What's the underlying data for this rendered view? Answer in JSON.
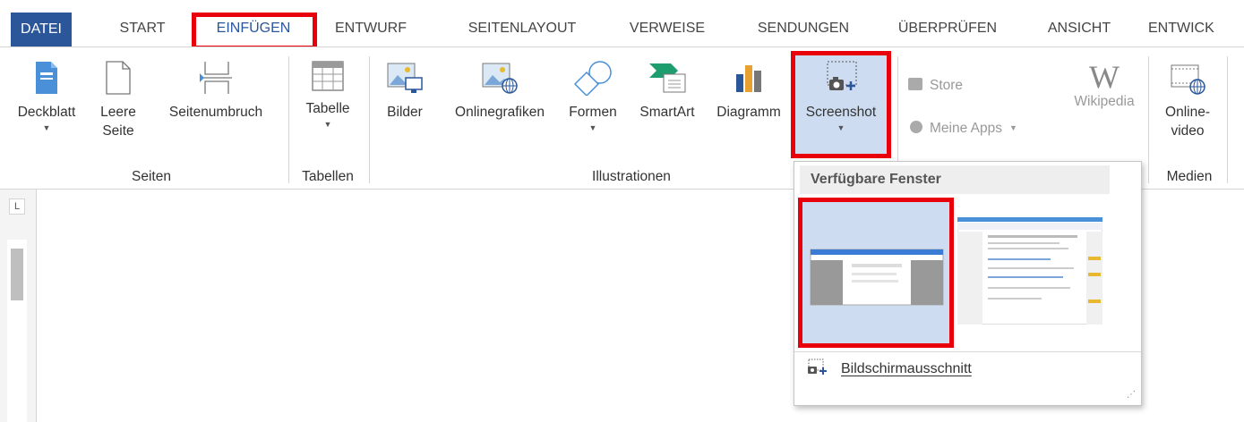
{
  "tabs": [
    {
      "id": "datei",
      "label": "DATEI"
    },
    {
      "id": "start",
      "label": "START"
    },
    {
      "id": "einfuegen",
      "label": "EINFÜGEN"
    },
    {
      "id": "entwurf",
      "label": "ENTWURF"
    },
    {
      "id": "seitenlayout",
      "label": "SEITENLAYOUT"
    },
    {
      "id": "verweise",
      "label": "VERWEISE"
    },
    {
      "id": "sendungen",
      "label": "SENDUNGEN"
    },
    {
      "id": "ueberpruefen",
      "label": "ÜBERPRÜFEN"
    },
    {
      "id": "ansicht",
      "label": "ANSICHT"
    },
    {
      "id": "entwicklertools",
      "label": "ENTWICK"
    }
  ],
  "ribbon": {
    "seiten": {
      "label": "Seiten",
      "deckblatt": "Deckblatt",
      "leere_seite_1": "Leere",
      "leere_seite_2": "Seite",
      "seitenumbruch": "Seitenumbruch"
    },
    "tabellen": {
      "label": "Tabellen",
      "tabelle": "Tabelle"
    },
    "illustrationen": {
      "label": "Illustrationen",
      "bilder": "Bilder",
      "onlinegrafiken": "Onlinegrafiken",
      "formen": "Formen",
      "smartart": "SmartArt",
      "diagramm": "Diagramm",
      "screenshot": "Screenshot"
    },
    "apps": {
      "store": "Store",
      "meine_apps": "Meine Apps",
      "wikipedia": "Wikipedia"
    },
    "medien": {
      "label": "Medien",
      "onlinevideo_1": "Online-",
      "onlinevideo_2": "video"
    }
  },
  "dropdown": {
    "header": "Verfügbare Fenster",
    "screen_clipping": "Bildschirmausschnitt"
  },
  "colors": {
    "accent": "#2b579a",
    "highlight": "#e8000b",
    "selected": "#cddcf0"
  }
}
